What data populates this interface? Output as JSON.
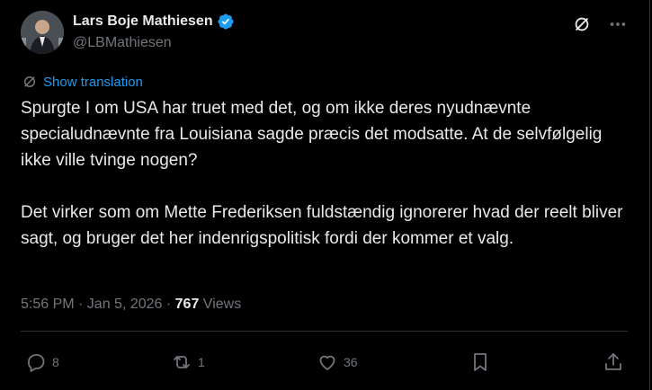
{
  "author": {
    "name": "Lars Boje Mathiesen",
    "handle": "@LBMathiesen"
  },
  "translate_label": "Show translation",
  "tweet_text": "Spurgte I om USA har truet med det, og om ikke deres nyudnævnte specialudnævnte fra Louisiana sagde præcis det modsatte. At de selvfølgelig ikke ville tvinge nogen?\n\nDet virker som om Mette Frederiksen fuldstændig ignorerer hvad der reelt bliver sagt, og bruger det her indenrigspolitisk fordi der kommer et valg.",
  "meta": {
    "timestamp": "5:56 PM · Jan 5, 2026 · ",
    "views_count": "767",
    "views_label": " Views"
  },
  "actions": {
    "replies": "8",
    "reposts": "1",
    "likes": "36"
  },
  "colors": {
    "accent": "#1d9bf0",
    "muted": "#71767b",
    "text": "#e7e9ea",
    "background": "#000000"
  },
  "icons": [
    "grok-icon",
    "more-icon",
    "translate-icon",
    "reply-icon",
    "repost-icon",
    "like-icon",
    "bookmark-icon",
    "share-icon",
    "verified-badge-icon"
  ]
}
